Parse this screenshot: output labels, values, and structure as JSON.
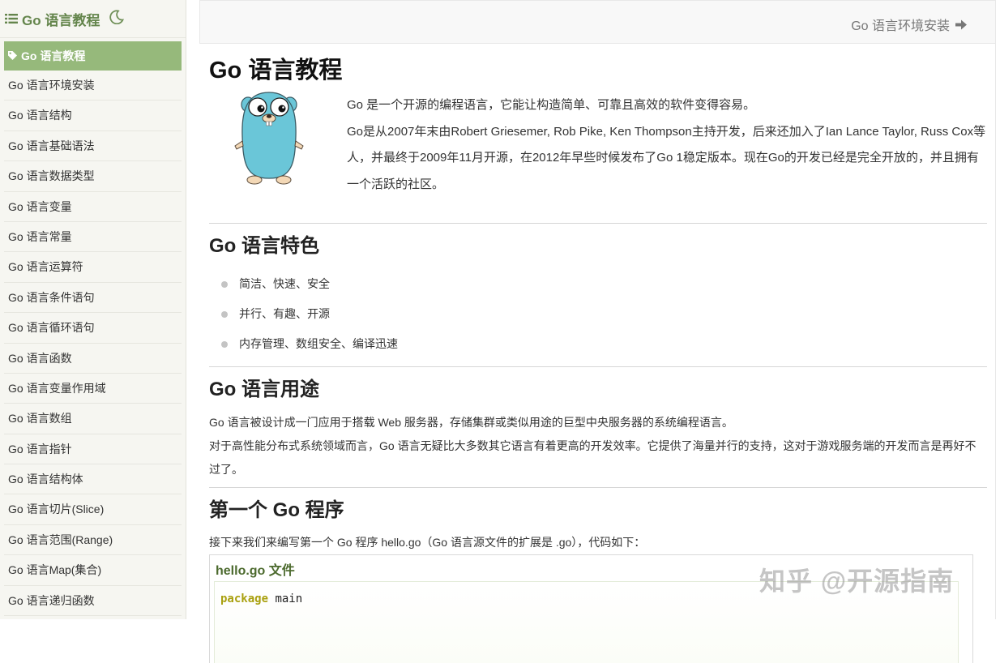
{
  "sidebar": {
    "title": "Go 语言教程",
    "items": [
      {
        "label": "Go 语言教程",
        "active": true
      },
      {
        "label": "Go 语言环境安装"
      },
      {
        "label": "Go 语言结构"
      },
      {
        "label": "Go 语言基础语法"
      },
      {
        "label": "Go 语言数据类型"
      },
      {
        "label": "Go 语言变量"
      },
      {
        "label": "Go 语言常量"
      },
      {
        "label": "Go 语言运算符"
      },
      {
        "label": "Go 语言条件语句"
      },
      {
        "label": "Go 语言循环语句"
      },
      {
        "label": "Go 语言函数"
      },
      {
        "label": "Go 语言变量作用域"
      },
      {
        "label": "Go 语言数组"
      },
      {
        "label": "Go 语言指针"
      },
      {
        "label": "Go 语言结构体"
      },
      {
        "label": "Go 语言切片(Slice)"
      },
      {
        "label": "Go 语言范围(Range)"
      },
      {
        "label": "Go 语言Map(集合)"
      },
      {
        "label": "Go 语言递归函数"
      }
    ]
  },
  "topbar": {
    "next_label": "Go 语言环境安装"
  },
  "main": {
    "title": "Go 语言教程",
    "intro_1": "Go 是一个开源的编程语言，它能让构造简单、可靠且高效的软件变得容易。",
    "intro_2": "Go是从2007年末由Robert Griesemer, Rob Pike, Ken Thompson主持开发，后来还加入了Ian Lance Taylor, Russ Cox等人，并最终于2009年11月开源，在2012年早些时候发布了Go 1稳定版本。现在Go的开发已经是完全开放的，并且拥有一个活跃的社区。",
    "features_title": "Go 语言特色",
    "features": [
      "简洁、快速、安全",
      "并行、有趣、开源",
      "内存管理、数组安全、编译迅速"
    ],
    "usage_title": "Go 语言用途",
    "usage_1": "Go 语言被设计成一门应用于搭载 Web 服务器，存储集群或类似用途的巨型中央服务器的系统编程语言。",
    "usage_2": "对于高性能分布式系统领域而言，Go 语言无疑比大多数其它语言有着更高的开发效率。它提供了海量并行的支持，这对于游戏服务端的开发而言是再好不过了。",
    "first_program_title": "第一个 Go 程序",
    "first_program_desc": "接下来我们来编写第一个 Go 程序 hello.go（Go 语言源文件的扩展是 .go），代码如下：",
    "code_title": "hello.go 文件",
    "code_keyword": "package",
    "code_rest": " main"
  },
  "watermark": "知乎 @开源指南",
  "colors": {
    "accent": "#96b97b",
    "header_green": "#64854c",
    "sidebar_bg": "#f6f6f1"
  }
}
